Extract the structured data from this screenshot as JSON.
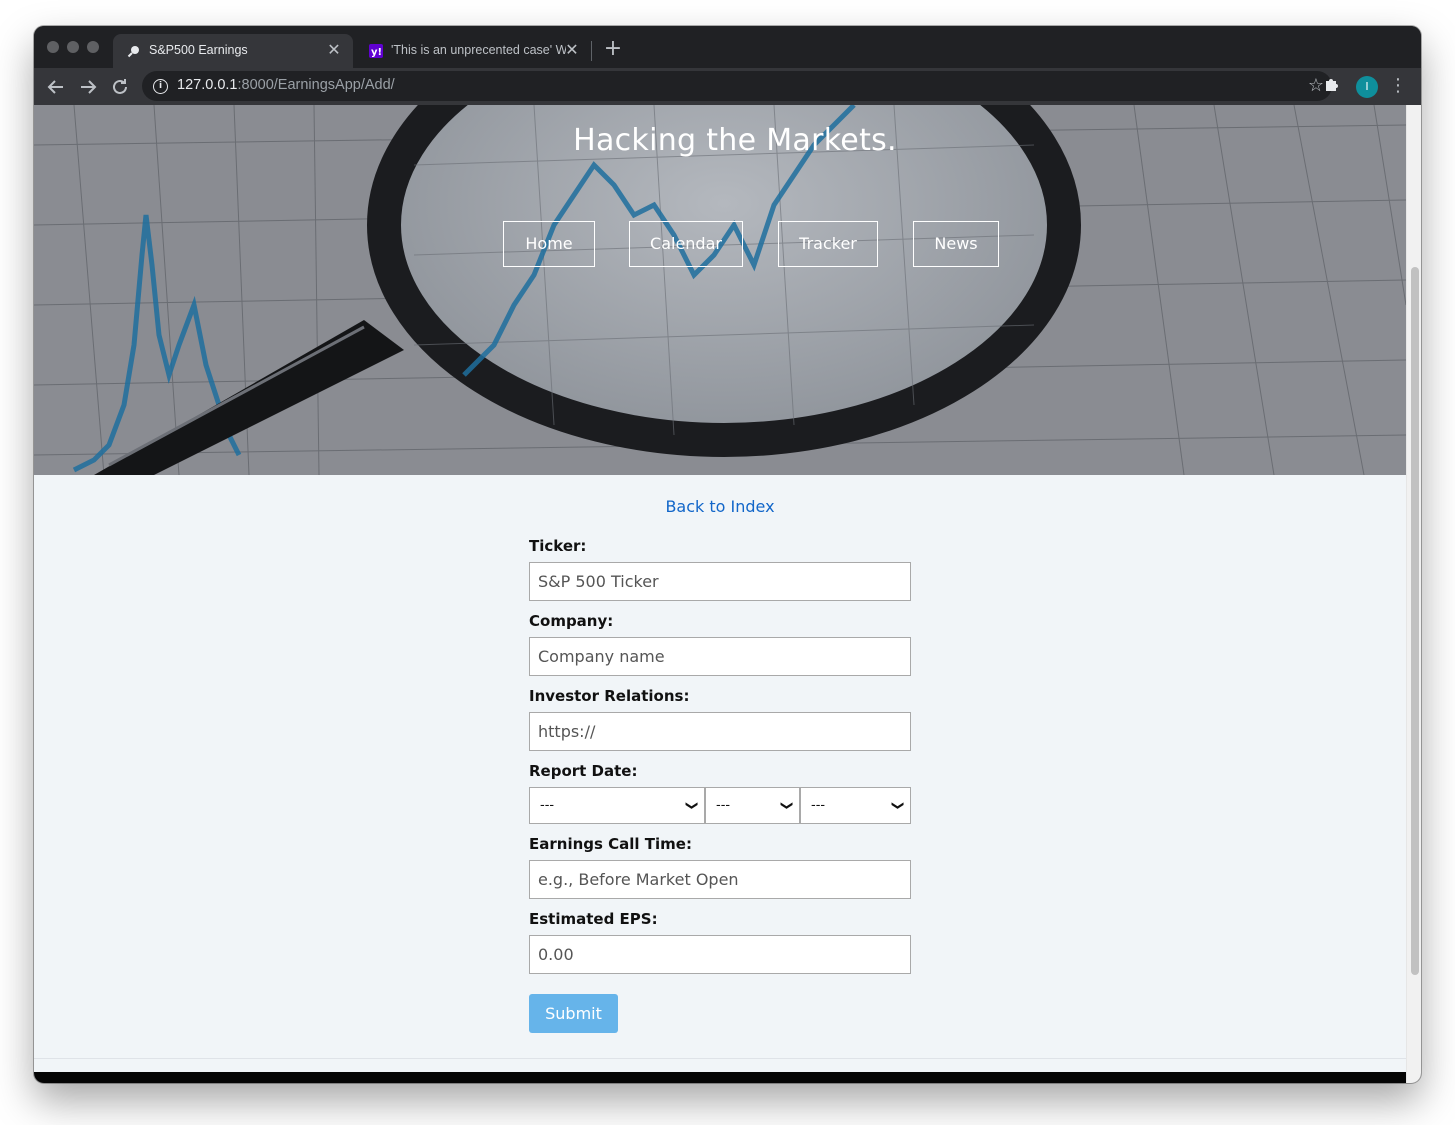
{
  "browser": {
    "tabs": [
      {
        "title": "S&P500 Earnings",
        "close": "✕"
      },
      {
        "title": "'This is an unprecented case' W",
        "close": "✕"
      }
    ],
    "new_tab": "+",
    "url_host": "127.0.0.1",
    "url_rest": ":8000/EarningsApp/Add/",
    "avatar_letter": "I",
    "colors": {
      "avatar": "#0f8f9c",
      "chrome_dark": "#202124"
    }
  },
  "hero": {
    "title": "Hacking the Markets.",
    "nav": [
      "Home",
      "Calendar",
      "Tracker",
      "News"
    ]
  },
  "back_link": "Back to Index",
  "form": {
    "ticker": {
      "label": "Ticker:",
      "placeholder": "S&P 500 Ticker"
    },
    "company": {
      "label": "Company:",
      "placeholder": "Company name"
    },
    "investor_relations": {
      "label": "Investor Relations:",
      "value": "https://"
    },
    "report_date": {
      "label": "Report Date:",
      "month": "---",
      "day": "---",
      "year": "---"
    },
    "call_time": {
      "label": "Earnings Call Time:",
      "placeholder": "e.g., Before Market Open"
    },
    "eps": {
      "label": "Estimated EPS:",
      "value": "0.00"
    },
    "submit": "Submit",
    "colors": {
      "submit": "#66b4ea",
      "link": "#1266c9"
    }
  }
}
